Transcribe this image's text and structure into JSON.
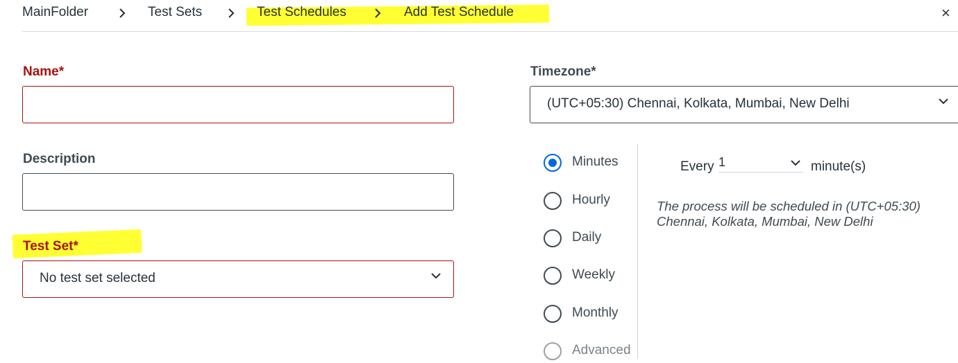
{
  "breadcrumb": {
    "items": [
      "MainFolder",
      "Test Sets",
      "Test Schedules",
      "Add Test Schedule"
    ],
    "separator": ">"
  },
  "close_label": "×",
  "form": {
    "name_label": "Name*",
    "name_value": "",
    "description_label": "Description",
    "description_value": "",
    "test_set_label": "Test Set*",
    "test_set_value": "No test set selected",
    "timezone_label": "Timezone*",
    "timezone_value": "(UTC+05:30) Chennai, Kolkata, Mumbai, New Delhi"
  },
  "frequency": {
    "options": [
      "Minutes",
      "Hourly",
      "Daily",
      "Weekly",
      "Monthly",
      "Advanced"
    ],
    "selected": "Minutes",
    "every_label": "Every",
    "every_value": "1",
    "unit_label": "minute(s)",
    "note": "The process will be scheduled in (UTC+05:30) Chennai, Kolkata, Mumbai, New Delhi"
  },
  "colors": {
    "required": "#a6120d",
    "accent": "#0067df",
    "highlight": "#ffff33"
  }
}
